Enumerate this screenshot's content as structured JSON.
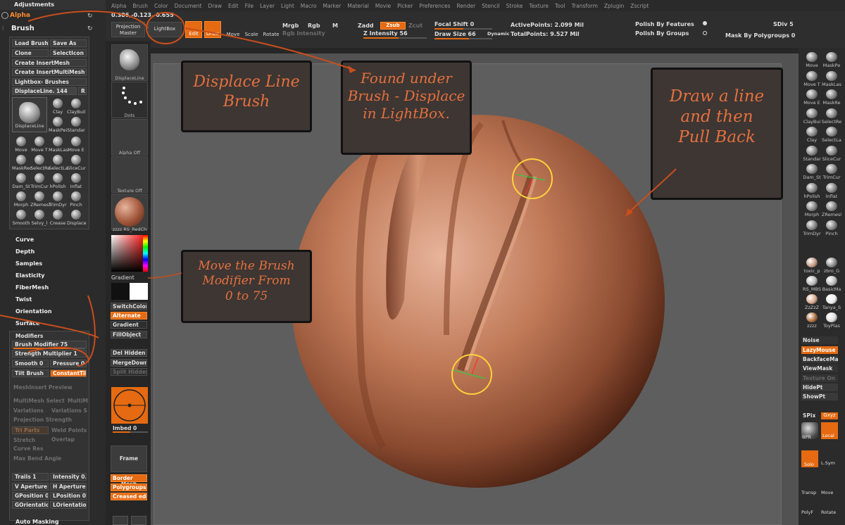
{
  "menu": [
    "Alpha",
    "Brush",
    "Color",
    "Document",
    "Draw",
    "Edit",
    "File",
    "Layer",
    "Light",
    "Macro",
    "Marker",
    "Material",
    "Movie",
    "Picker",
    "Preferences",
    "Render",
    "Stencil",
    "Stroke",
    "Texture",
    "Tool",
    "Transform",
    "Zplugin",
    "Zscript"
  ],
  "toolbar": {
    "coords": "0.386,-0.123,-0.655",
    "projection_master": "Projection Master",
    "lightbox": "LightBox",
    "edit": "Edit",
    "draw": "Draw",
    "move": "Move",
    "scale": "Scale",
    "rotate": "Rotate",
    "mrgb": "Mrgb",
    "rgb": "Rgb",
    "m": "M",
    "zadd": "Zadd",
    "zsub": "Zsub",
    "zcut": "Zcut",
    "rgb_intensity": "Rgb Intensity",
    "z_intensity": "Z Intensity 56",
    "focal_shift": "Focal Shift 0",
    "draw_size": "Draw Size 66",
    "dynamic": "Dynamic",
    "active_points": "ActivePoints: 2.099  Mil",
    "total_points": "TotalPoints: 9.527  Mil",
    "polish_features": "Polish By Features",
    "polish_groups": "Polish By Groups",
    "sdiv": "SDiv 5",
    "mask_polygroups": "Mask By Polygroups 0"
  },
  "left": {
    "header": "Adjustments",
    "alpha": "Alpha",
    "brush": "Brush",
    "load_brush": "Load Brush",
    "save_as": "Save As",
    "clone": "Clone",
    "select_icon": "SelectIcon",
    "create_insertmesh": "Create InsertMesh",
    "create_insertmultimesh": "Create InsertMultiMesh",
    "lightbox_brushes": "Lightbox› Brushes",
    "current_brush": "DisplaceLine. 144",
    "r": "R",
    "current_label": "DisplaceLine",
    "brushes": [
      "Clay",
      "ClayBuil",
      "MaskPei",
      "Standar",
      "Move",
      "Move T",
      "MaskLas",
      "Move E",
      "MaskRec",
      "SelectRe",
      "SelectLa",
      "SliceCur",
      "Dam_St",
      "TrimCur",
      "hPolish",
      "Inflat",
      "Morph",
      "ZRemesl",
      "TrimDyr",
      "Pinch",
      "Smooth",
      "Selvy_l",
      "Crease",
      "Displace"
    ],
    "sections": [
      "Curve",
      "Depth",
      "Samples",
      "Elasticity",
      "FiberMesh",
      "Twist",
      "Orientation",
      "Surface"
    ],
    "modifiers": "Modifiers",
    "brush_modifier": "Brush Modifier 75",
    "strength_multiplier": "Strength Multiplier 1",
    "smooth": "Smooth 0",
    "pressure": "Pressure 0",
    "tilt_brush": "Tilt Brush",
    "constant_tilt": "ConstantTilt",
    "meshinsert_preview": "MeshInsert Preview",
    "multimesh_select": "MultiMesh Select",
    "multi": "MultiM",
    "variations": "Variations",
    "variations_s": "Variations S",
    "projection_strength": "Projection Strength",
    "tri_parts": "Tri Parts",
    "weld_points": "Weld Points",
    "stretch": "Stretch",
    "overlap": "Overlap",
    "curve_res": "Curve Res",
    "max_bend_angle": "Max Bend Angle",
    "trails": "Trails 1",
    "intensity": "Intensity 0.",
    "v_aperture": "V Aperture",
    "h_aperture": "H Aperture",
    "gposition": "GPosition 0.",
    "lposition": "LPosition 0.2",
    "gorientation": "GOrientation",
    "lorientation": "LOrientation",
    "auto_masking": "Auto Masking"
  },
  "shelf": {
    "brush_thumb": "DisplaceLine",
    "stroke_thumb": "Dots",
    "alpha_thumb": "Alpha Off",
    "texture_thumb": "Texture Off",
    "material_thumb": "zzzz RS_RedCh",
    "gradient": "Gradient",
    "switch_color": "SwitchColor",
    "alternate": "Alternate",
    "gradient2": "Gradient",
    "fill_object": "FillObject",
    "del_hidden": "Del Hidden",
    "merge_down": "MergeDown",
    "split_hidden": "Split Hidden",
    "imbed": "Imbed 0",
    "frame_mesh": "Frame Mesh",
    "border": "Border",
    "polygroups": "Polygroups",
    "creased_edges": "Creased edg"
  },
  "right": {
    "brushes": [
      "Move",
      "MaskPe",
      "Move T",
      "MaskLas",
      "Move E",
      "MaskRe",
      "ClayBui",
      "SelectRe",
      "Clay",
      "SelectLa",
      "Standar",
      "SliceCur",
      "Dam_St",
      "TrimCur",
      "hPolish",
      "Inflat",
      "Morph",
      "ZRemesl",
      "TrimDyr",
      "Pinch"
    ],
    "materials": [
      "toxic_p",
      "zbro_G",
      "RS_MBS",
      "BasicMa",
      "ZzZzZ",
      "Tanya_S",
      "zzzz",
      "ToyPlas"
    ],
    "noise": "Noise",
    "lazymouse": "LazyMouse",
    "backface": "BackfaceMas",
    "viewmask": "ViewMask",
    "texture_on": "Texture On",
    "hidept": "HidePt",
    "showpt": "ShowPt",
    "spix": "SPix",
    "xyz": "Gxyz",
    "bpr": "BPR",
    "local": "Local",
    "solo": "Solo",
    "lsym": "L.Sym",
    "transp": "Transp",
    "move": "Move",
    "polyf": "PolyF",
    "rotate": "Rotate"
  },
  "notes": {
    "displace": "Displace Line\nBrush",
    "found": "Found under\nBrush - Displace\nin LightBox.",
    "draw": "Draw a line\nand then\nPull Back",
    "move": "Move the Brush\nModifier From\n0  to  75"
  }
}
